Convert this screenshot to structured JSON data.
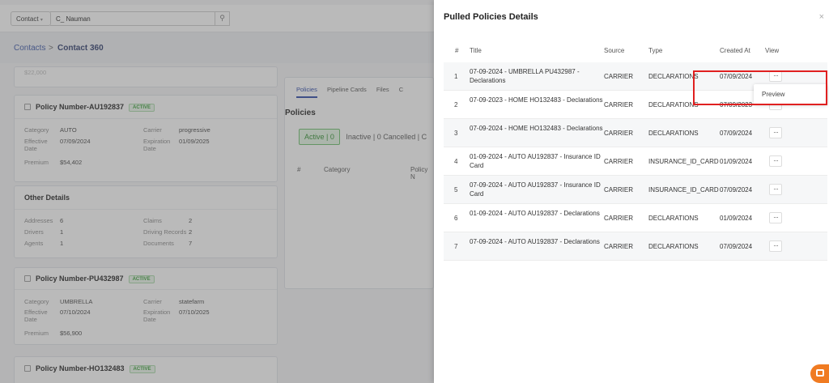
{
  "topbar": {
    "select_value": "Contact",
    "search_value": "C_ Nauman"
  },
  "breadcrumb": {
    "parent": "Contacts",
    "separator": ">",
    "current": "Contact 360"
  },
  "cards": {
    "partial_value": "$22,000",
    "policy1": {
      "title": "Policy Number-AU192837",
      "badge": "ACTIVE",
      "category_label": "Category",
      "category": "AUTO",
      "carrier_label": "Carrier",
      "carrier": "progressive",
      "effective_label": "Effective Date",
      "effective": "07/09/2024",
      "expiration_label": "Expiration Date",
      "expiration": "01/09/2025",
      "premium_label": "Premium",
      "premium": "$54,402"
    },
    "other": {
      "title": "Other Details",
      "addresses_label": "Addresses",
      "addresses": "6",
      "claims_label": "Claims",
      "claims": "2",
      "drivers_label": "Drivers",
      "drivers": "1",
      "driving_label": "Driving Records",
      "driving": "2",
      "agents_label": "Agents",
      "agents": "1",
      "documents_label": "Documents",
      "documents": "7"
    },
    "policy2": {
      "title": "Policy Number-PU432987",
      "badge": "ACTIVE",
      "category_label": "Category",
      "category": "UMBRELLA",
      "carrier_label": "Carrier",
      "carrier": "statefarm",
      "effective_label": "Effective Date",
      "effective": "07/10/2024",
      "expiration_label": "Expiration Date",
      "expiration": "07/10/2025",
      "premium_label": "Premium",
      "premium": "$56,900"
    },
    "policy3": {
      "title": "Policy Number-HO132483",
      "badge": "ACTIVE"
    }
  },
  "middle": {
    "tabs": [
      "Policies",
      "Pipeline Cards",
      "Files",
      "C"
    ],
    "heading": "Policies",
    "filter_active": "Active | 0",
    "filter_rest": "Inactive | 0  Cancelled | C",
    "col_num": "#",
    "col_category": "Category",
    "col_policy": "Policy N"
  },
  "drawer": {
    "title": "Pulled Policies Details",
    "close": "×",
    "headers": {
      "num": "#",
      "title": "Title",
      "source": "Source",
      "type": "Type",
      "created": "Created At",
      "view": "View"
    },
    "rows": [
      {
        "num": "1",
        "title": "07-09-2024 - UMBRELLA PU432987 - Declarations",
        "source": "CARRIER",
        "type": "DECLARATIONS",
        "created": "07/09/2024",
        "more": "···"
      },
      {
        "num": "2",
        "title": "07-09-2023 - HOME HO132483 - Declarations",
        "source": "CARRIER",
        "type": "DECLARATIONS",
        "created": "07/09/2023",
        "more": "···"
      },
      {
        "num": "3",
        "title": "07-09-2024 - HOME HO132483 - Declarations",
        "source": "CARRIER",
        "type": "DECLARATIONS",
        "created": "07/09/2024",
        "more": "···"
      },
      {
        "num": "4",
        "title": "01-09-2024 - AUTO AU192837 - Insurance ID Card",
        "source": "CARRIER",
        "type": "INSURANCE_ID_CARD",
        "created": "01/09/2024",
        "more": "···"
      },
      {
        "num": "5",
        "title": "07-09-2024 - AUTO AU192837 - Insurance ID Card",
        "source": "CARRIER",
        "type": "INSURANCE_ID_CARD",
        "created": "07/09/2024",
        "more": "···"
      },
      {
        "num": "6",
        "title": "01-09-2024 - AUTO AU192837 - Declarations",
        "source": "CARRIER",
        "type": "DECLARATIONS",
        "created": "01/09/2024",
        "more": "···"
      },
      {
        "num": "7",
        "title": "07-09-2024 - AUTO AU192837 - Declarations",
        "source": "CARRIER",
        "type": "DECLARATIONS",
        "created": "07/09/2024",
        "more": "···"
      }
    ],
    "menu_item": "Preview"
  },
  "icons": {
    "search": "search-icon",
    "chevron": "chevron-down-icon",
    "chat": "chat-icon"
  }
}
